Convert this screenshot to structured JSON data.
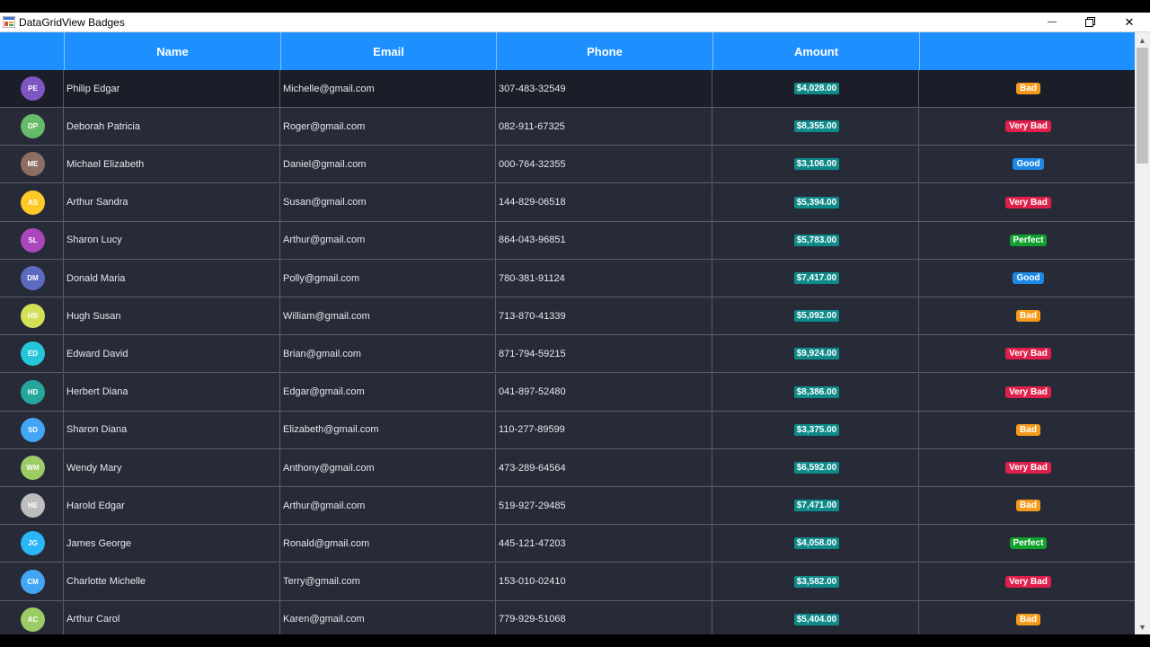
{
  "window": {
    "title": "DataGridView Badges",
    "minimize_glyph": "—",
    "maximize_icon": "restore-icon",
    "close_glyph": "✕"
  },
  "grid": {
    "columns": [
      "",
      "Name",
      "Email",
      "Phone",
      "Amount",
      ""
    ],
    "rows": [
      {
        "initials": "PE",
        "avatar_color": "#7e57c2",
        "name": "Philip Edgar",
        "email": "Michelle@gmail.com",
        "phone": "307-483-32549",
        "amount": "$4,028.00",
        "badge": "Bad",
        "badge_color": "#f59a1b"
      },
      {
        "initials": "DP",
        "avatar_color": "#66bb6a",
        "name": "Deborah Patricia",
        "email": "Roger@gmail.com",
        "phone": "082-911-67325",
        "amount": "$8,355.00",
        "badge": "Very Bad",
        "badge_color": "#e0204a"
      },
      {
        "initials": "ME",
        "avatar_color": "#8d6e63",
        "name": "Michael Elizabeth",
        "email": "Daniel@gmail.com",
        "phone": "000-764-32355",
        "amount": "$3,106.00",
        "badge": "Good",
        "badge_color": "#1e88e5"
      },
      {
        "initials": "AS",
        "avatar_color": "#ffca28",
        "name": "Arthur Sandra",
        "email": "Susan@gmail.com",
        "phone": "144-829-06518",
        "amount": "$5,394.00",
        "badge": "Very Bad",
        "badge_color": "#e0204a"
      },
      {
        "initials": "SL",
        "avatar_color": "#ab47bc",
        "name": "Sharon Lucy",
        "email": "Arthur@gmail.com",
        "phone": "864-043-96851",
        "amount": "$5,783.00",
        "badge": "Perfect",
        "badge_color": "#10a02c"
      },
      {
        "initials": "DM",
        "avatar_color": "#5c6bc0",
        "name": "Donald Maria",
        "email": "Polly@gmail.com",
        "phone": "780-381-91124",
        "amount": "$7,417.00",
        "badge": "Good",
        "badge_color": "#1e88e5"
      },
      {
        "initials": "HS",
        "avatar_color": "#d4e157",
        "name": "Hugh Susan",
        "email": "William@gmail.com",
        "phone": "713-870-41339",
        "amount": "$5,092.00",
        "badge": "Bad",
        "badge_color": "#f59a1b"
      },
      {
        "initials": "ED",
        "avatar_color": "#26c6da",
        "name": "Edward David",
        "email": "Brian@gmail.com",
        "phone": "871-794-59215",
        "amount": "$9,924.00",
        "badge": "Very Bad",
        "badge_color": "#e0204a"
      },
      {
        "initials": "HD",
        "avatar_color": "#26a69a",
        "name": "Herbert Diana",
        "email": "Edgar@gmail.com",
        "phone": "041-897-52480",
        "amount": "$8,386.00",
        "badge": "Very Bad",
        "badge_color": "#e0204a"
      },
      {
        "initials": "SD",
        "avatar_color": "#42a5f5",
        "name": "Sharon Diana",
        "email": "Elizabeth@gmail.com",
        "phone": "110-277-89599",
        "amount": "$3,375.00",
        "badge": "Bad",
        "badge_color": "#f59a1b"
      },
      {
        "initials": "WM",
        "avatar_color": "#9ccc65",
        "name": "Wendy Mary",
        "email": "Anthony@gmail.com",
        "phone": "473-289-64564",
        "amount": "$6,592.00",
        "badge": "Very Bad",
        "badge_color": "#e0204a"
      },
      {
        "initials": "HE",
        "avatar_color": "#bdbdbd",
        "name": "Harold Edgar",
        "email": "Arthur@gmail.com",
        "phone": "519-927-29485",
        "amount": "$7,471.00",
        "badge": "Bad",
        "badge_color": "#f59a1b"
      },
      {
        "initials": "JG",
        "avatar_color": "#29b6f6",
        "name": "James George",
        "email": "Ronald@gmail.com",
        "phone": "445-121-47203",
        "amount": "$4,058.00",
        "badge": "Perfect",
        "badge_color": "#10a02c"
      },
      {
        "initials": "CM",
        "avatar_color": "#42a5f5",
        "name": "Charlotte Michelle",
        "email": "Terry@gmail.com",
        "phone": "153-010-02410",
        "amount": "$3,582.00",
        "badge": "Very Bad",
        "badge_color": "#e0204a"
      },
      {
        "initials": "AC",
        "avatar_color": "#9ccc65",
        "name": "Arthur Carol",
        "email": "Karen@gmail.com",
        "phone": "779-929-51068",
        "amount": "$5,404.00",
        "badge": "Bad",
        "badge_color": "#f59a1b"
      }
    ]
  },
  "scrollbar": {
    "up_glyph": "▲",
    "down_glyph": "▼"
  },
  "colors": {
    "header_bg": "#1e8fff",
    "grid_bg": "#272b38",
    "amount_bg": "#0f8a8a"
  }
}
